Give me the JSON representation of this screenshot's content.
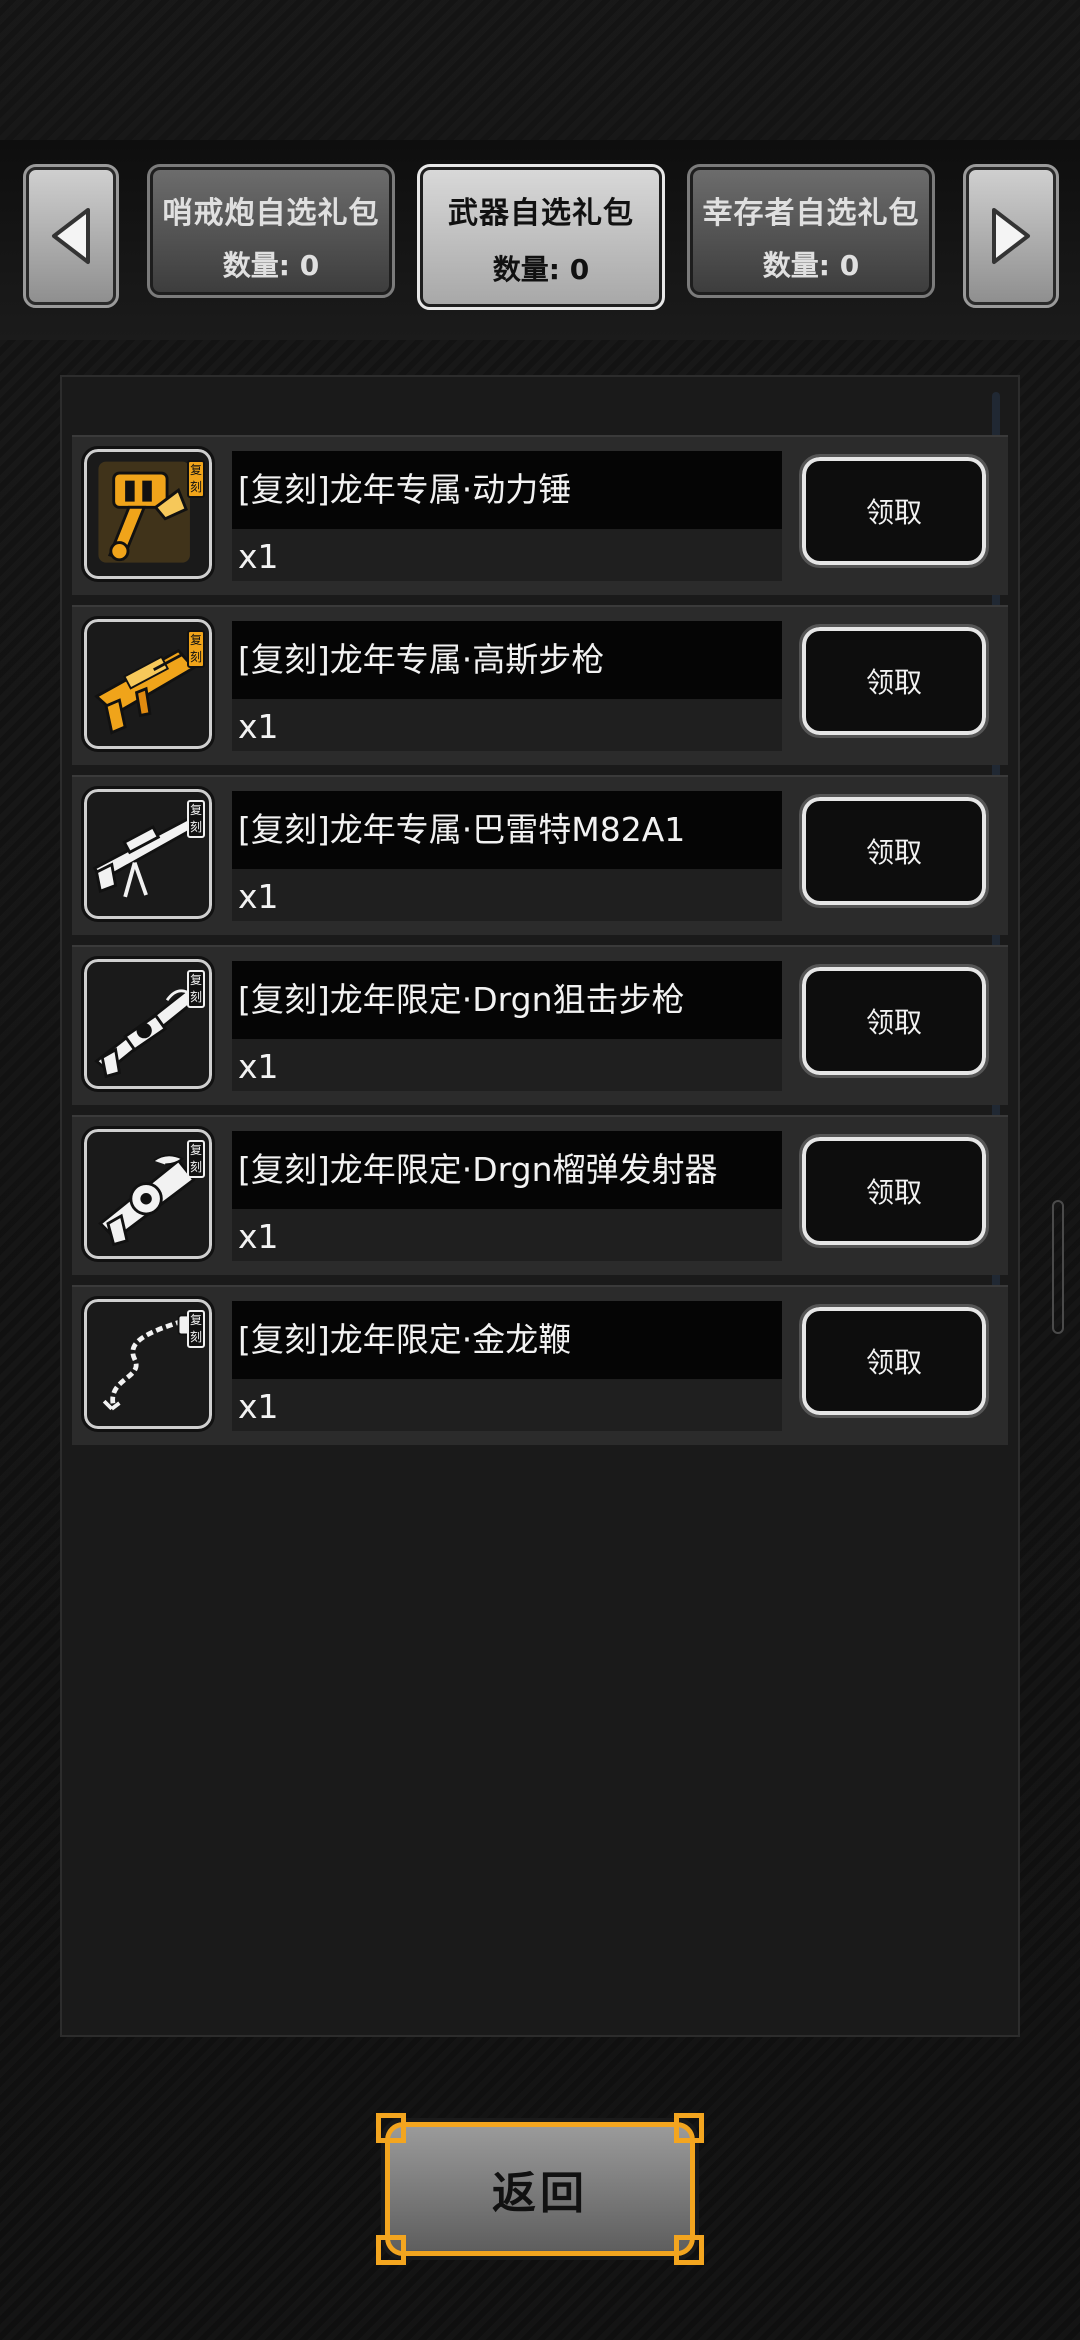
{
  "tabs": [
    {
      "name": "哨戒炮自选礼包",
      "qty": "数量: 0",
      "active": false
    },
    {
      "name": "武器自选礼包",
      "qty": "数量: 0",
      "active": true
    },
    {
      "name": "幸存者自选礼包",
      "qty": "数量: 0",
      "active": false
    }
  ],
  "items": [
    {
      "name": "[复刻]龙年专属·动力锤",
      "qty": "x1",
      "button": "领取",
      "badge": "复刻",
      "icon": "power-hammer-icon",
      "icon_color": "#f0a41a"
    },
    {
      "name": "[复刻]龙年专属·高斯步枪",
      "qty": "x1",
      "button": "领取",
      "badge": "复刻",
      "icon": "gauss-rifle-icon",
      "icon_color": "#f0a41a"
    },
    {
      "name": "[复刻]龙年专属·巴雷特M82A1",
      "qty": "x1",
      "button": "领取",
      "badge": "复刻",
      "icon": "sniper-rifle-icon",
      "icon_color": "#f2f2f2"
    },
    {
      "name": "[复刻]龙年限定·Drgn狙击步枪",
      "qty": "x1",
      "button": "领取",
      "badge": "复刻",
      "icon": "dragon-sniper-icon",
      "icon_color": "#f2f2f2"
    },
    {
      "name": "[复刻]龙年限定·Drgn榴弹发射器",
      "qty": "x1",
      "button": "领取",
      "badge": "复刻",
      "icon": "grenade-launcher-icon",
      "icon_color": "#f2f2f2"
    },
    {
      "name": "[复刻]龙年限定·金龙鞭",
      "qty": "x1",
      "button": "领取",
      "badge": "复刻",
      "icon": "dragon-whip-icon",
      "icon_color": "#f2f2f2"
    }
  ],
  "back_button": "返回",
  "colors": {
    "accent_gold": "#f3a51f",
    "panel": "#1a1a1a",
    "row": "#2b2b2b"
  }
}
